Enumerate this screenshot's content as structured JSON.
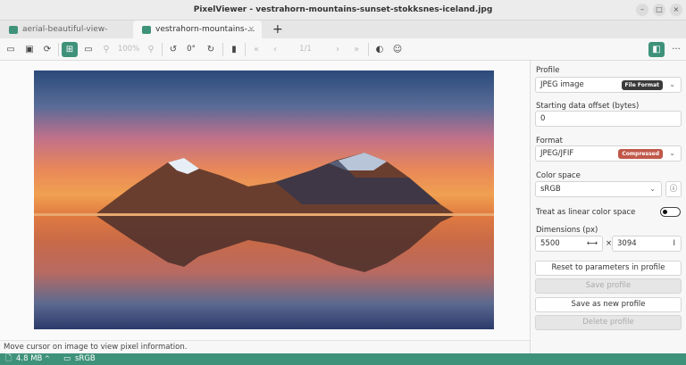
{
  "window": {
    "title": "PixelViewer - vestrahorn-mountains-sunset-stokksnes-iceland.jpg",
    "minimize": "–",
    "maximize": "□",
    "close": "×"
  },
  "tabs": [
    {
      "label": "aerial-beautiful-view-histori..."
    },
    {
      "label": "vestrahorn-mountains-...",
      "close": "×"
    }
  ],
  "new_tab": "+",
  "toolbar": {
    "zoom": "100%",
    "rotation": "0°",
    "page": "1/1",
    "more": "···"
  },
  "sidebar": {
    "profile_label": "Profile",
    "profile_value": "JPEG image",
    "profile_badge": "File Format",
    "offset_label": "Starting data offset (bytes)",
    "offset_value": "0",
    "format_label": "Format",
    "format_value": "JPEG/JFIF",
    "format_badge": "Compressed",
    "colorspace_label": "Color space",
    "colorspace_value": "sRGB",
    "linear_label": "Treat as linear color space",
    "linear_on": false,
    "dimensions_label": "Dimensions (px)",
    "width": "5500",
    "times": "×",
    "height": "3094",
    "reset_button": "Reset to parameters in profile",
    "save_button": "Save profile",
    "save_new_button": "Save as new profile",
    "delete_button": "Delete profile"
  },
  "status": {
    "message": "Move cursor on image to view pixel information.",
    "file_size": "4.8 MB",
    "color_space": "sRGB"
  },
  "colors": {
    "accent": "#3f927a",
    "badge_dark": "#3a3a3a",
    "badge_red": "#c0584a"
  }
}
